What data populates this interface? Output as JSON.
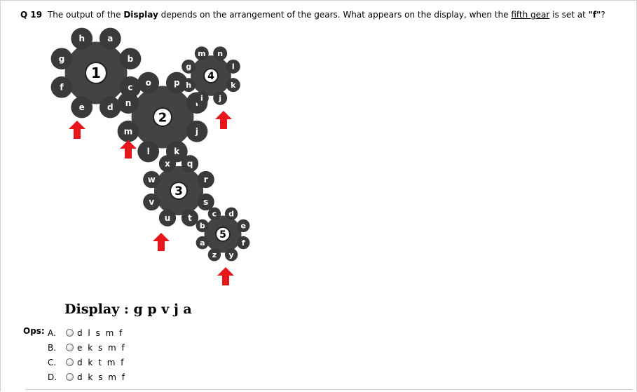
{
  "question": {
    "number": "Q 19",
    "part1": "The output of the",
    "bold_word": "Display",
    "part2": "depends on the arrangement of the gears. What appears on the display, when the",
    "underlined": "fifth gear",
    "part3": "is set at",
    "setting": "\"f\"",
    "end": "?"
  },
  "gears": [
    {
      "number": "1",
      "letters": [
        "a",
        "b",
        "c",
        "d",
        "e",
        "f",
        "g",
        "h"
      ]
    },
    {
      "number": "2",
      "letters": [
        "i",
        "j",
        "k",
        "l",
        "m",
        "n",
        "o",
        "p"
      ]
    },
    {
      "number": "3",
      "letters": [
        "q",
        "r",
        "s",
        "t",
        "u",
        "v",
        "w",
        "x"
      ]
    },
    {
      "number": "4",
      "letters": [
        "m",
        "n",
        "l",
        "k",
        "j",
        "i",
        "h",
        "g"
      ]
    },
    {
      "number": "5",
      "letters": [
        "d",
        "e",
        "f",
        "y",
        "z",
        "a",
        "b",
        "c"
      ]
    }
  ],
  "display_text": "Display : g p v j a",
  "ops_label": "Ops:",
  "options": [
    {
      "letter": "A.",
      "text": "d l s m f"
    },
    {
      "letter": "B.",
      "text": "e k s m f"
    },
    {
      "letter": "C.",
      "text": "d k t m f"
    },
    {
      "letter": "D.",
      "text": "d k s m f"
    }
  ],
  "colors": {
    "gear": "#434343",
    "gear_tooth": "#3a3a3a",
    "arrow": "#e8161b",
    "hub": "#ffffff"
  }
}
